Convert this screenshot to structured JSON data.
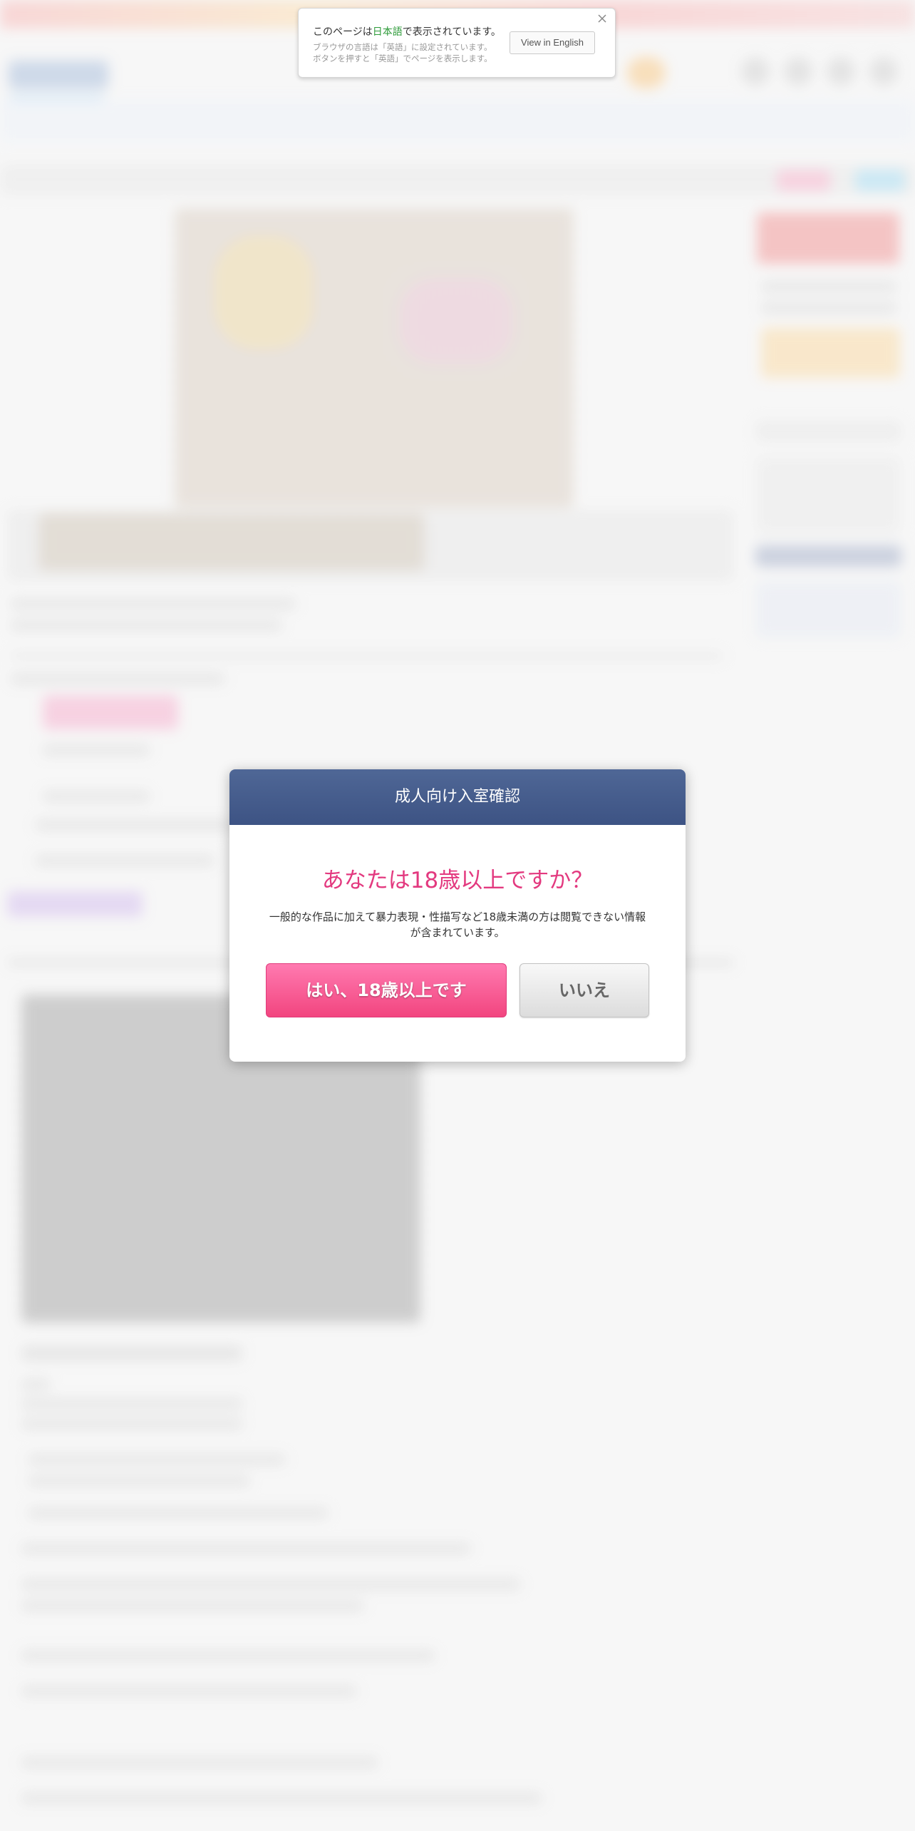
{
  "language_banner": {
    "message_prefix": "このページは",
    "message_language": "日本語",
    "message_suffix": "で表示されています。",
    "sub_line_1": "ブラウザの言語は「英語」に設定されています。",
    "sub_line_2": "ボタンを押すと「英語」でページを表示します。",
    "button_label": "View in English",
    "close_icon": "close-icon"
  },
  "age_modal": {
    "title": "成人向け入室確認",
    "question": "あなたは18歳以上ですか？",
    "description": "一般的な作品に加えて暴力表現・性描写など18歳未満の方は閲覧できない情報が含まれています。",
    "yes_label": "はい、18歳以上です",
    "no_label": "いいえ"
  },
  "colors": {
    "modal_header": "#44598a",
    "question_pink": "#e3397f",
    "yes_button": "#f8558f",
    "language_highlight": "#2e9b3a"
  }
}
